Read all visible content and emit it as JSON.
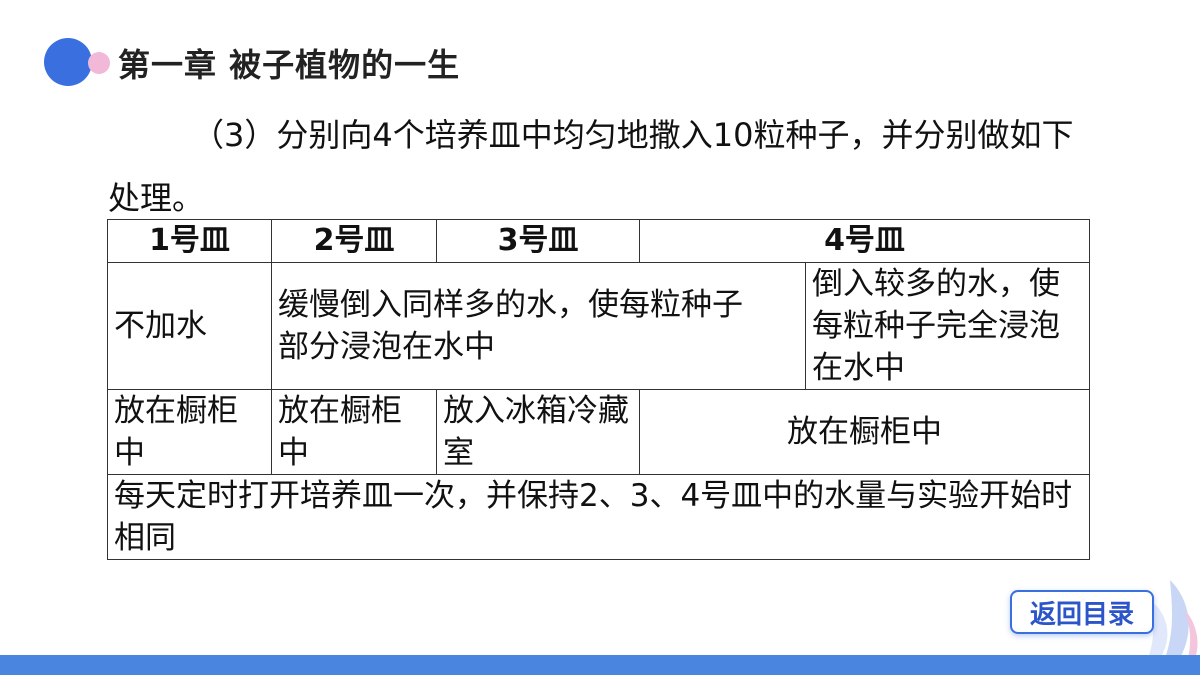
{
  "header": {
    "chapter_title": "第一章  被子植物的一生"
  },
  "intro_text": "（3）分别向4个培养皿中均匀地撒入10粒种子，并分别做如下处理。",
  "table": {
    "headers": [
      "1号皿",
      "2号皿",
      "3号皿",
      "4号皿"
    ],
    "water_row": {
      "dish1": "不加水",
      "dish2_3": "缓慢倒入同样多的水，使每粒种子部分浸泡在水中",
      "dish4": "倒入较多的水，使每粒种子完全浸泡在水中"
    },
    "place_row": {
      "dish1": "放在橱柜中",
      "dish2": "放在橱柜中",
      "dish3": "放入冰箱冷藏室",
      "dish4": "放在橱柜中"
    },
    "note": "每天定时打开培养皿一次，并保持2、3、4号皿中的水量与实验开始时相同"
  },
  "nav": {
    "return_label": "返回目录"
  },
  "colors": {
    "accent_blue": "#3a6fe0",
    "accent_pink": "#f2b8d8",
    "bar_blue": "#4a86e0"
  }
}
